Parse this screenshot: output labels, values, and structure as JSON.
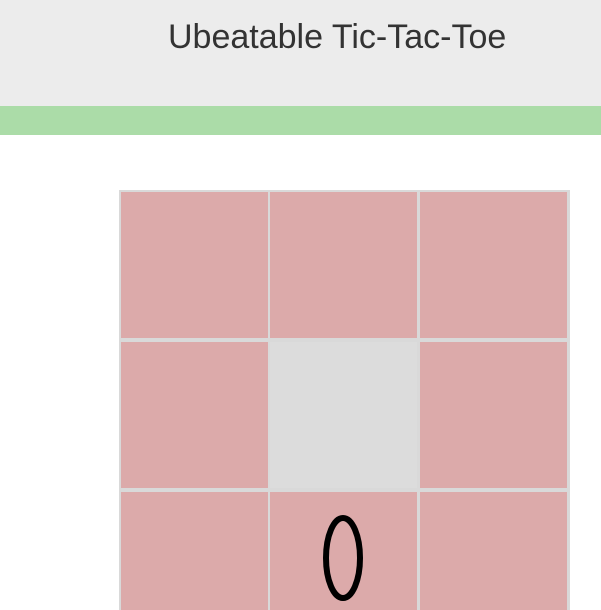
{
  "header": {
    "title": "Ubeatable Tic-Tac-Toe"
  },
  "colors": {
    "header_bg": "#ececec",
    "status_bar": "#abdca8",
    "cell_active": "#dcaaaa",
    "cell_inactive": "#dcdcdc",
    "grid_lines": "#d9d9d9",
    "mark": "#000000"
  },
  "board": {
    "cells": [
      {
        "row": 0,
        "col": 0,
        "mark": "",
        "highlighted": true
      },
      {
        "row": 0,
        "col": 1,
        "mark": "",
        "highlighted": true
      },
      {
        "row": 0,
        "col": 2,
        "mark": "",
        "highlighted": true
      },
      {
        "row": 1,
        "col": 0,
        "mark": "",
        "highlighted": true
      },
      {
        "row": 1,
        "col": 1,
        "mark": "",
        "highlighted": false
      },
      {
        "row": 1,
        "col": 2,
        "mark": "",
        "highlighted": true
      },
      {
        "row": 2,
        "col": 0,
        "mark": "",
        "highlighted": true
      },
      {
        "row": 2,
        "col": 1,
        "mark": "O",
        "highlighted": true
      },
      {
        "row": 2,
        "col": 2,
        "mark": "",
        "highlighted": true
      }
    ]
  }
}
